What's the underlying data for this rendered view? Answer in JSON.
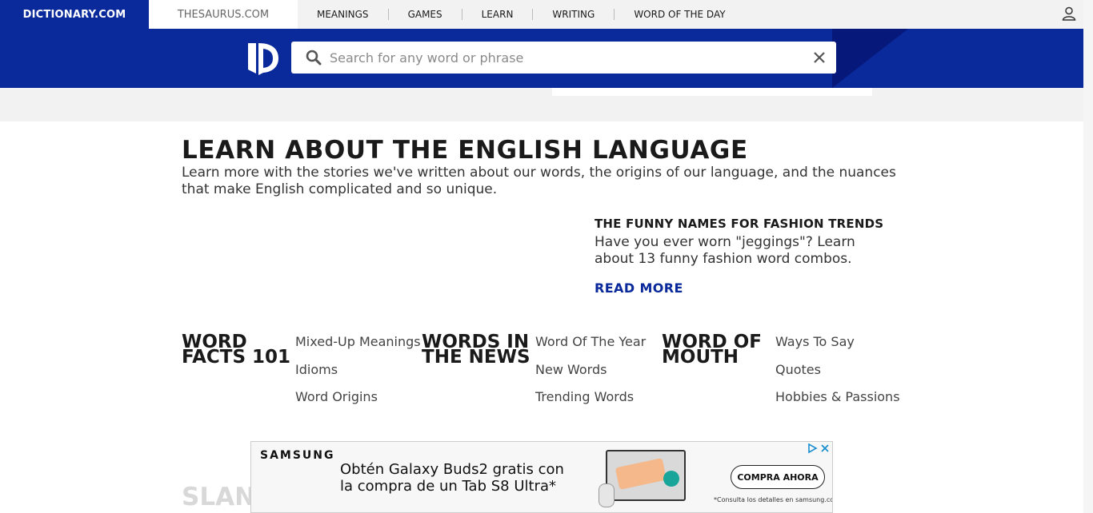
{
  "topnav": {
    "brand": "DICTIONARY.COM",
    "thesaurus": "THESAURUS.COM",
    "menu": [
      "MEANINGS",
      "GAMES",
      "LEARN",
      "WRITING",
      "WORD OF THE DAY"
    ]
  },
  "search": {
    "placeholder": "Search for any word or phrase",
    "value": ""
  },
  "learn": {
    "title": "LEARN ABOUT THE ENGLISH LANGUAGE",
    "description": "Learn more with the stories we've written about our words, the origins of our language, and the nuances that make English complicated and so unique."
  },
  "feature": {
    "title": "THE FUNNY NAMES FOR FASHION TRENDS",
    "description": "Have you ever worn \"jeggings\"? Learn about 13 funny fashion word combos.",
    "read_more": "READ MORE"
  },
  "categories": [
    {
      "heading": "WORD FACTS 101",
      "links": [
        "Mixed-Up Meanings",
        "Idioms",
        "Word Origins"
      ]
    },
    {
      "heading": "WORDS IN THE NEWS",
      "links": [
        "Word Of The Year",
        "New Words",
        "Trending Words"
      ]
    },
    {
      "heading": "WORD OF MOUTH",
      "links": [
        "Ways To Say",
        "Quotes",
        "Hobbies & Passions"
      ]
    }
  ],
  "next_section_partial": "SLAN",
  "ad": {
    "brand": "SAMSUNG",
    "headline": "Obtén Galaxy Buds2 gratis con la compra de un Tab S8 Ultra*",
    "cta": "COMPRA AHORA",
    "disclaimer": "*Consulta los detalles en samsung.com."
  },
  "colors": {
    "brand_blue": "#0a2a9c",
    "nav_gray": "#f2f2f2"
  }
}
